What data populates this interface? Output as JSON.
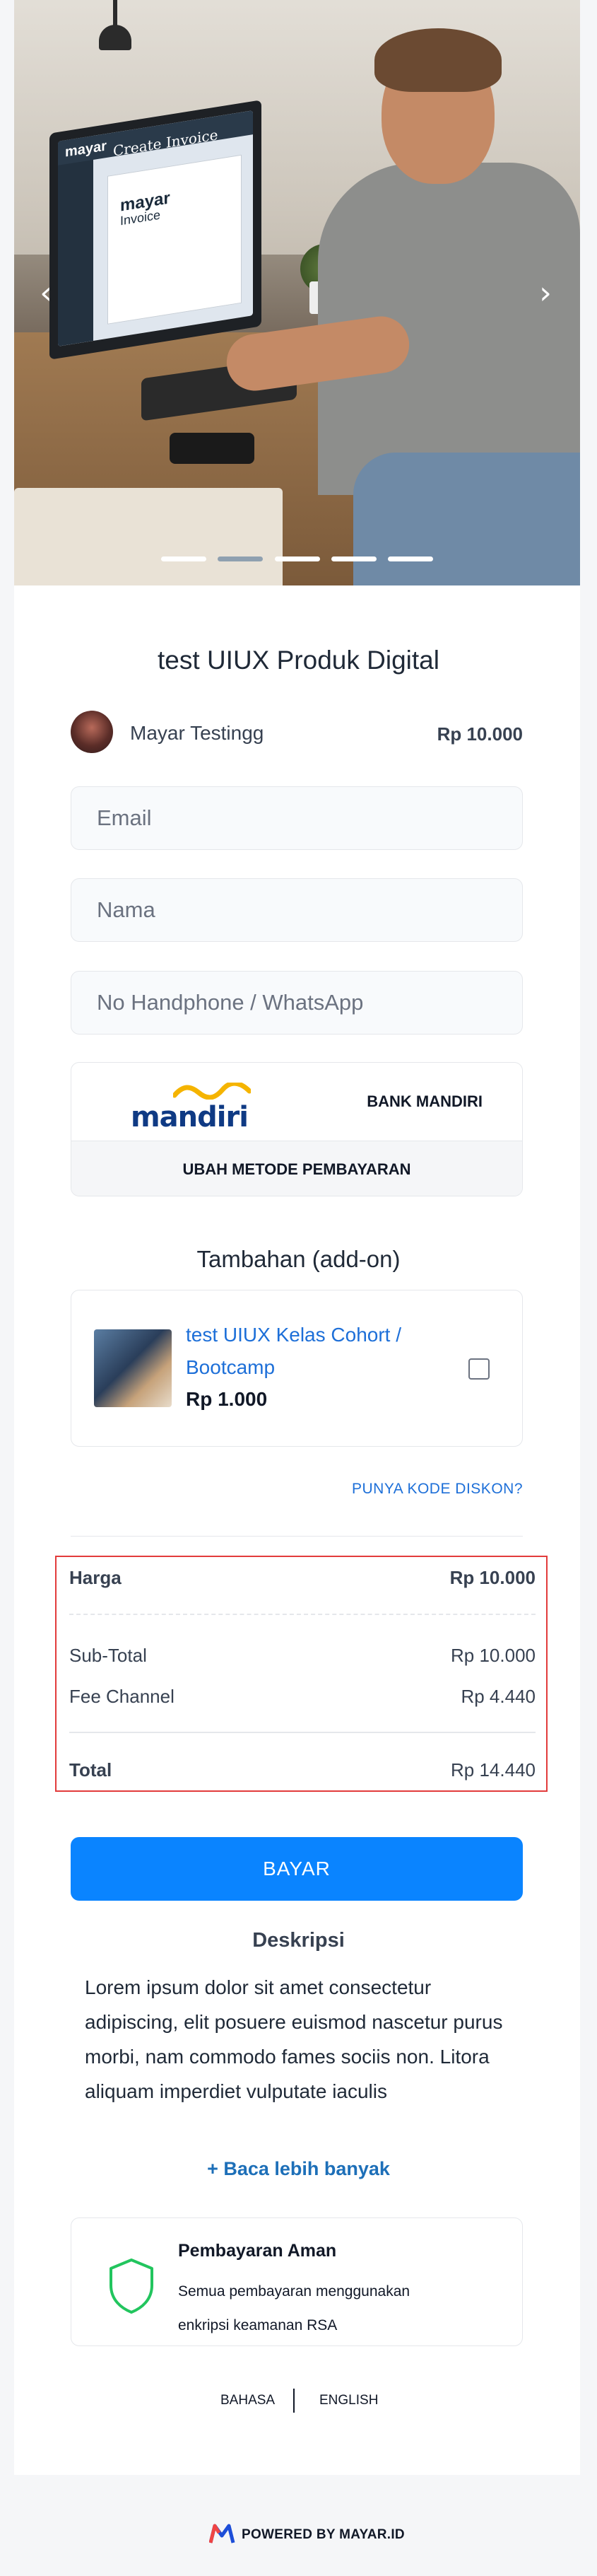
{
  "carousel": {
    "slide_image": {
      "screen_brand": "mayar",
      "screen_title": "Create Invoice",
      "doc_brand": "mayar",
      "doc_title": "Invoice"
    },
    "slide_count": 5,
    "active_slide": 2
  },
  "product": {
    "title": "test UIUX Produk Digital",
    "seller_name": "Mayar Testingg",
    "price": "Rp 10.000"
  },
  "form": {
    "email_placeholder": "Email",
    "name_placeholder": "Nama",
    "phone_placeholder": "No Handphone / WhatsApp"
  },
  "payment": {
    "bank_logo_text": "mandiri",
    "bank_name": "BANK MANDIRI",
    "change_label": "UBAH METODE PEMBAYARAN"
  },
  "addons": {
    "title": "Tambahan (add-on)",
    "items": [
      {
        "name": "test UIUX Kelas Cohort / Bootcamp",
        "price": "Rp 1.000",
        "checked": false
      }
    ]
  },
  "discount_link": "PUNYA KODE DISKON?",
  "summary": {
    "harga_label": "Harga",
    "harga_value": "Rp 10.000",
    "subtotal_label": "Sub-Total",
    "subtotal_value": "Rp 10.000",
    "fee_label": "Fee Channel",
    "fee_value": "Rp 4.440",
    "total_label": "Total",
    "total_value": "Rp 14.440"
  },
  "pay_button": "BAYAR",
  "description": {
    "title": "Deskripsi",
    "text": "Lorem ipsum dolor sit amet consectetur adipiscing, elit posuere euismod nascetur purus morbi, nam commodo fames sociis non. Litora aliquam imperdiet vulputate iaculis",
    "more_label": "+ Baca lebih banyak"
  },
  "secure": {
    "title": "Pembayaran Aman",
    "text": "Semua pembayaran menggunakan enkripsi keamanan RSA"
  },
  "language": {
    "label": "BAHASA",
    "value": "ENGLISH"
  },
  "footer": {
    "powered_by": "POWERED BY MAYAR.ID"
  },
  "colors": {
    "primary": "#0a84ff",
    "link": "#1d6fd8",
    "highlight_border": "#e23b3b",
    "shield": "#22c55e",
    "mandiri_blue": "#0f3a84",
    "mandiri_gold": "#f5b400"
  }
}
